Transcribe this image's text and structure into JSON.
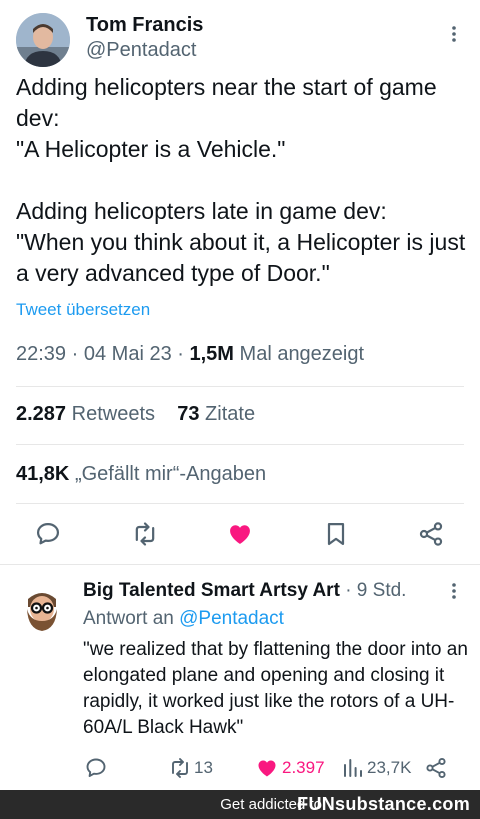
{
  "tweet": {
    "author_name": "Tom Francis",
    "author_handle": "@Pentadact",
    "text_p1": "Adding helicopters near the start of game dev:\n\"A Helicopter is a Vehicle.\"",
    "text_p2": "Adding helicopters late in game dev:\n\"When you think about it, a Helicopter is just a very advanced type of Door.\"",
    "translate_label": "Tweet übersetzen",
    "time": "22:39",
    "dot1": "·",
    "date": "04 Mai 23",
    "dot2": "·",
    "views_count": "1,5M",
    "views_label": "Mal angezeigt",
    "retweets_count": "2.287",
    "retweets_label": "Retweets",
    "quotes_count": "73",
    "quotes_label": "Zitate",
    "likes_count": "41,8K",
    "likes_label": "„Gefällt mir“-Angaben"
  },
  "reply": {
    "author_name": "Big Talented Smart Artsy Art",
    "separator": "·",
    "time": "9 Std.",
    "reply_to_label": "Antwort an",
    "reply_to_handle": "@Pentadact",
    "text": "\"we realized that by flattening the door into an elongated plane and opening and closing it rapidly, it worked just like the rotors of a UH-60A/L Black Hawk\"",
    "retweets": "13",
    "likes": "2.397",
    "views": "23,7K"
  },
  "footer": {
    "text": "Get addicted to",
    "brand": "FUNsubstance.com"
  },
  "icons": {
    "reply": "comment-icon",
    "retweet": "retweet-icon",
    "like": "heart-icon",
    "bookmark": "bookmark-icon",
    "share": "share-icon",
    "views": "bar-chart-icon",
    "more": "more-vertical-icon"
  },
  "colors": {
    "accent": "#1d9bf0",
    "like": "#f91880",
    "text": "#0f1419",
    "secondary": "#536471"
  }
}
